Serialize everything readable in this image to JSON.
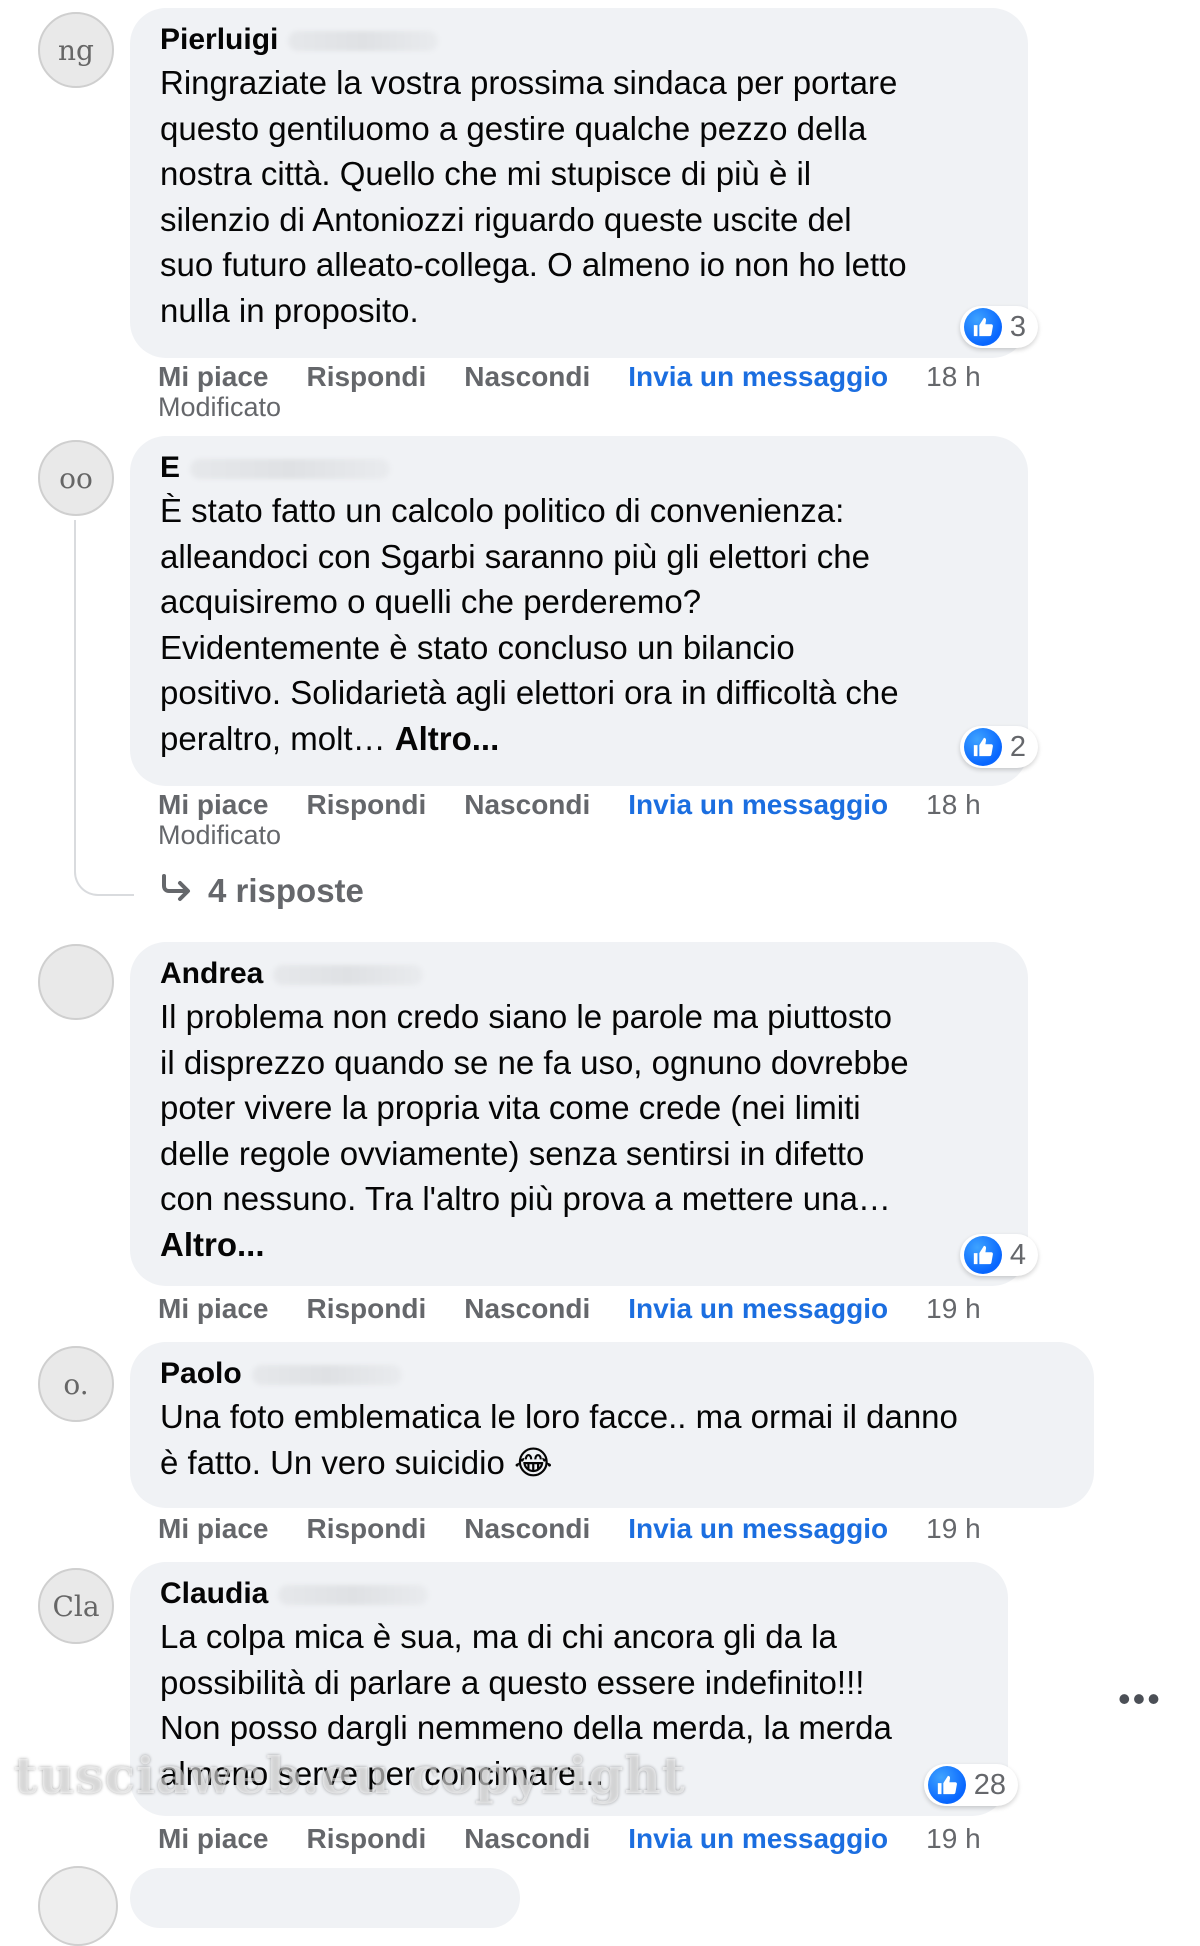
{
  "actions": {
    "like": "Mi piace",
    "reply": "Rispondi",
    "hide": "Nascondi",
    "message": "Invia un messaggio",
    "edited": "Modificato"
  },
  "comments": [
    {
      "author": "Pierluigi",
      "avatar_text": "ng",
      "text": "Ringraziate la vostra prossima sindaca per portare\nquesto gentiluomo a gestire qualche pezzo della\nnostra città. Quello che mi stupisce di più è il\nsilenzio di Antoniozzi riguardo queste uscite del\nsuo futuro alleato-collega. O almeno io non ho letto\nnulla in proposito.",
      "more": "",
      "likes": "3",
      "time": "18 h",
      "edited": true
    },
    {
      "author": "E",
      "avatar_text": "oo",
      "text": "È stato fatto un calcolo politico di convenienza:\nalleandoci con Sgarbi saranno più gli elettori che\nacquisiremo o quelli che perderemo?\nEvidentemente è stato concluso un bilancio\npositivo. Solidarietà agli elettori ora in difficoltà che\nperaltro, molt… ",
      "more": "Altro...",
      "likes": "2",
      "time": "18 h",
      "edited": true,
      "replies": "4 risposte"
    },
    {
      "author": "Andrea",
      "avatar_text": "",
      "text": "Il problema non credo siano le parole ma piuttosto\nil disprezzo quando se ne fa uso, ognuno dovrebbe\npoter vivere la propria vita come crede (nei limiti\ndelle regole ovviamente) senza sentirsi in difetto\ncon nessuno. Tra l'altro più prova a mettere una…\n",
      "more": "Altro...",
      "likes": "4",
      "time": "19 h",
      "edited": false
    },
    {
      "author": "Paolo",
      "avatar_text": "o.",
      "text": "Una foto emblematica le loro facce.. ma ormai il danno\nè fatto. Un vero suicidio 😂",
      "more": "",
      "likes": "",
      "time": "19 h",
      "edited": false
    },
    {
      "author": "Claudia",
      "avatar_text": "Cla",
      "text": "La colpa mica è sua, ma di chi ancora gli da la\npossibilità di parlare a questo essere indefinito!!!\nNon posso dargli nemmeno della merda, la merda\nalmeno serve per concimare...",
      "more": "",
      "likes": "28",
      "time": "19 h",
      "edited": false
    }
  ],
  "more_options": "•••",
  "watermark": "tusciaweb.eu copyright",
  "colors": {
    "bubble": "#f0f2f5",
    "link": "#1b6ee0",
    "secondary_text": "#65676b",
    "like_blue": "#0866ff"
  },
  "icons": {
    "like": "like-thumb-icon",
    "reply_arrow": "reply-arrow-icon",
    "more": "more-options-icon"
  }
}
